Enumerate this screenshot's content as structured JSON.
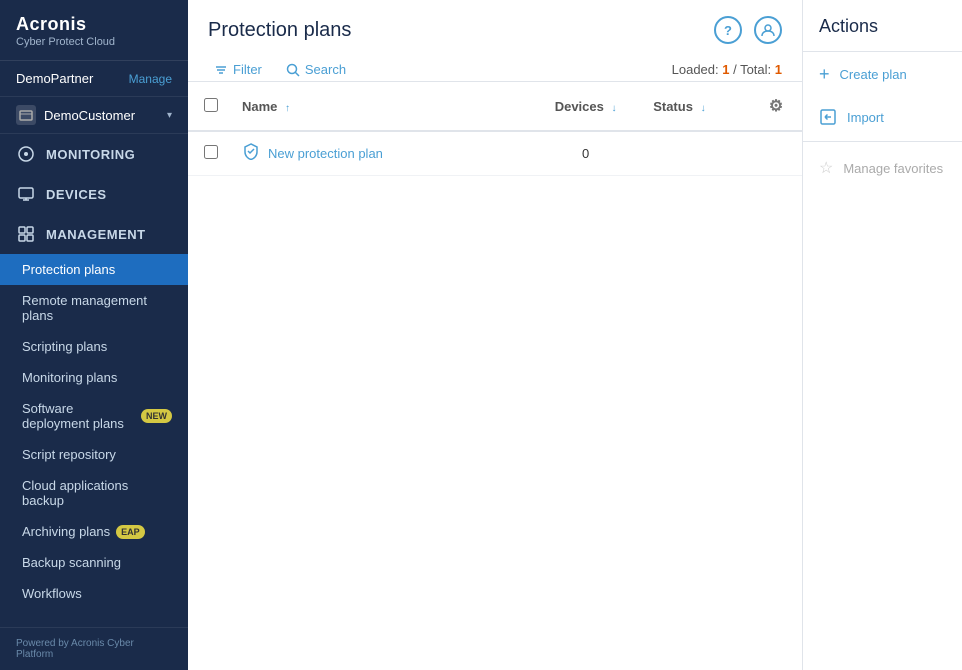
{
  "sidebar": {
    "logo": {
      "brand": "Acronis",
      "subtitle": "Cyber Protect Cloud"
    },
    "partner": {
      "name": "DemoPartner",
      "manage_label": "Manage"
    },
    "customer": {
      "name": "DemoCustomer"
    },
    "nav": [
      {
        "id": "monitoring",
        "label": "MONITORING",
        "icon": "○"
      },
      {
        "id": "devices",
        "label": "DEVICES",
        "icon": "▣"
      },
      {
        "id": "management",
        "label": "MANAGEMENT",
        "icon": "⊞"
      }
    ],
    "sub_items": [
      {
        "id": "protection-plans",
        "label": "Protection plans",
        "active": true,
        "badge": null
      },
      {
        "id": "remote-management-plans",
        "label": "Remote management plans",
        "active": false,
        "badge": null
      },
      {
        "id": "scripting-plans",
        "label": "Scripting plans",
        "active": false,
        "badge": null
      },
      {
        "id": "monitoring-plans",
        "label": "Monitoring plans",
        "active": false,
        "badge": null
      },
      {
        "id": "software-deployment-plans",
        "label": "Software deployment plans",
        "active": false,
        "badge": "NEW"
      },
      {
        "id": "script-repository",
        "label": "Script repository",
        "active": false,
        "badge": null
      },
      {
        "id": "cloud-applications-backup",
        "label": "Cloud applications backup",
        "active": false,
        "badge": null
      },
      {
        "id": "archiving-plans",
        "label": "Archiving plans",
        "active": false,
        "badge": "EAP"
      },
      {
        "id": "backup-scanning",
        "label": "Backup scanning",
        "active": false,
        "badge": null
      },
      {
        "id": "workflows",
        "label": "Workflows",
        "active": false,
        "badge": null
      }
    ],
    "footer": "Powered by Acronis Cyber Platform"
  },
  "main": {
    "page_title": "Protection plans",
    "toolbar": {
      "filter_label": "Filter",
      "search_label": "Search"
    },
    "loaded_info": {
      "label": "Loaded: 1 / Total: 1",
      "loaded": "1",
      "total": "1"
    },
    "table": {
      "columns": [
        {
          "id": "name",
          "label": "Name",
          "sortable": true,
          "sort_dir": "asc"
        },
        {
          "id": "devices",
          "label": "Devices",
          "sortable": true,
          "sort_dir": "desc"
        },
        {
          "id": "status",
          "label": "Status",
          "sortable": true,
          "sort_dir": "desc"
        }
      ],
      "rows": [
        {
          "id": "row-1",
          "name": "New protection plan",
          "devices": "0",
          "status": ""
        }
      ]
    }
  },
  "actions": {
    "title": "Actions",
    "items": [
      {
        "id": "create-plan",
        "label": "Create plan",
        "icon": "+",
        "disabled": false
      },
      {
        "id": "import",
        "label": "Import",
        "icon": "↩",
        "disabled": false
      },
      {
        "id": "manage-favorites",
        "label": "Manage favorites",
        "icon": "☆",
        "disabled": true
      }
    ]
  }
}
